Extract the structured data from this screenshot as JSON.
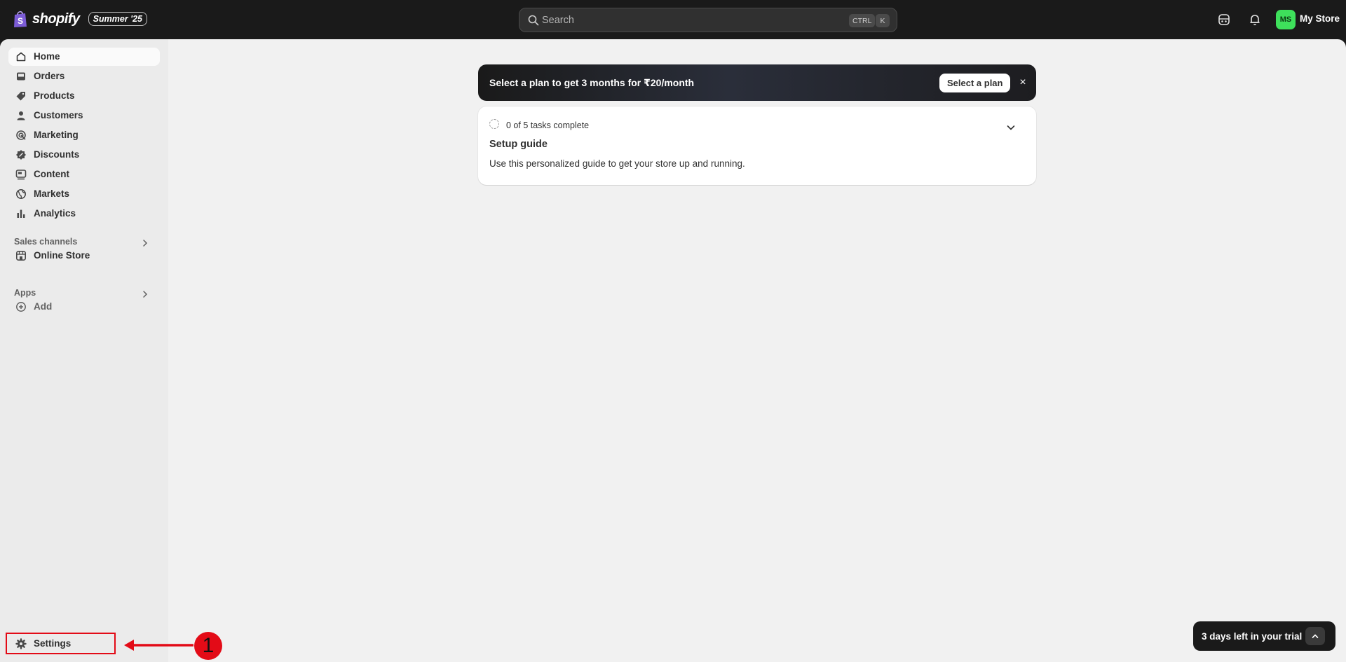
{
  "topbar": {
    "brand": "shopify",
    "edition": "Summer '25",
    "search": {
      "placeholder": "Search",
      "shortcut_ctrl": "CTRL",
      "shortcut_key": "K"
    },
    "store": {
      "initials": "MS",
      "name": "My Store",
      "avatar_color": "#3ee05b"
    }
  },
  "sidebar": {
    "items": [
      {
        "label": "Home",
        "icon": "home-icon"
      },
      {
        "label": "Orders",
        "icon": "inbox-icon"
      },
      {
        "label": "Products",
        "icon": "tag-icon"
      },
      {
        "label": "Customers",
        "icon": "person-icon"
      },
      {
        "label": "Marketing",
        "icon": "target-icon"
      },
      {
        "label": "Discounts",
        "icon": "discount-icon"
      },
      {
        "label": "Content",
        "icon": "image-icon"
      },
      {
        "label": "Markets",
        "icon": "globe-icon"
      },
      {
        "label": "Analytics",
        "icon": "bar-chart-icon"
      }
    ],
    "sales_channels": {
      "title": "Sales channels",
      "items": [
        {
          "label": "Online Store",
          "icon": "store-icon"
        }
      ]
    },
    "apps": {
      "title": "Apps",
      "add_label": "Add"
    },
    "settings_label": "Settings"
  },
  "promo": {
    "text": "Select a plan to get 3 months for ₹20/month",
    "button_label": "Select a plan",
    "close_label": "×"
  },
  "setup_guide": {
    "progress_text": "0 of 5 tasks complete",
    "title": "Setup guide",
    "description": "Use this personalized guide to get your store up and running."
  },
  "trial": {
    "text": "3 days left in your trial"
  },
  "annotation": {
    "step_number": "1",
    "color": "#e30b17"
  },
  "colors": {
    "topbar": "#1a1a1a",
    "sidebar": "#ebebeb",
    "content": "#f1f1f1"
  }
}
